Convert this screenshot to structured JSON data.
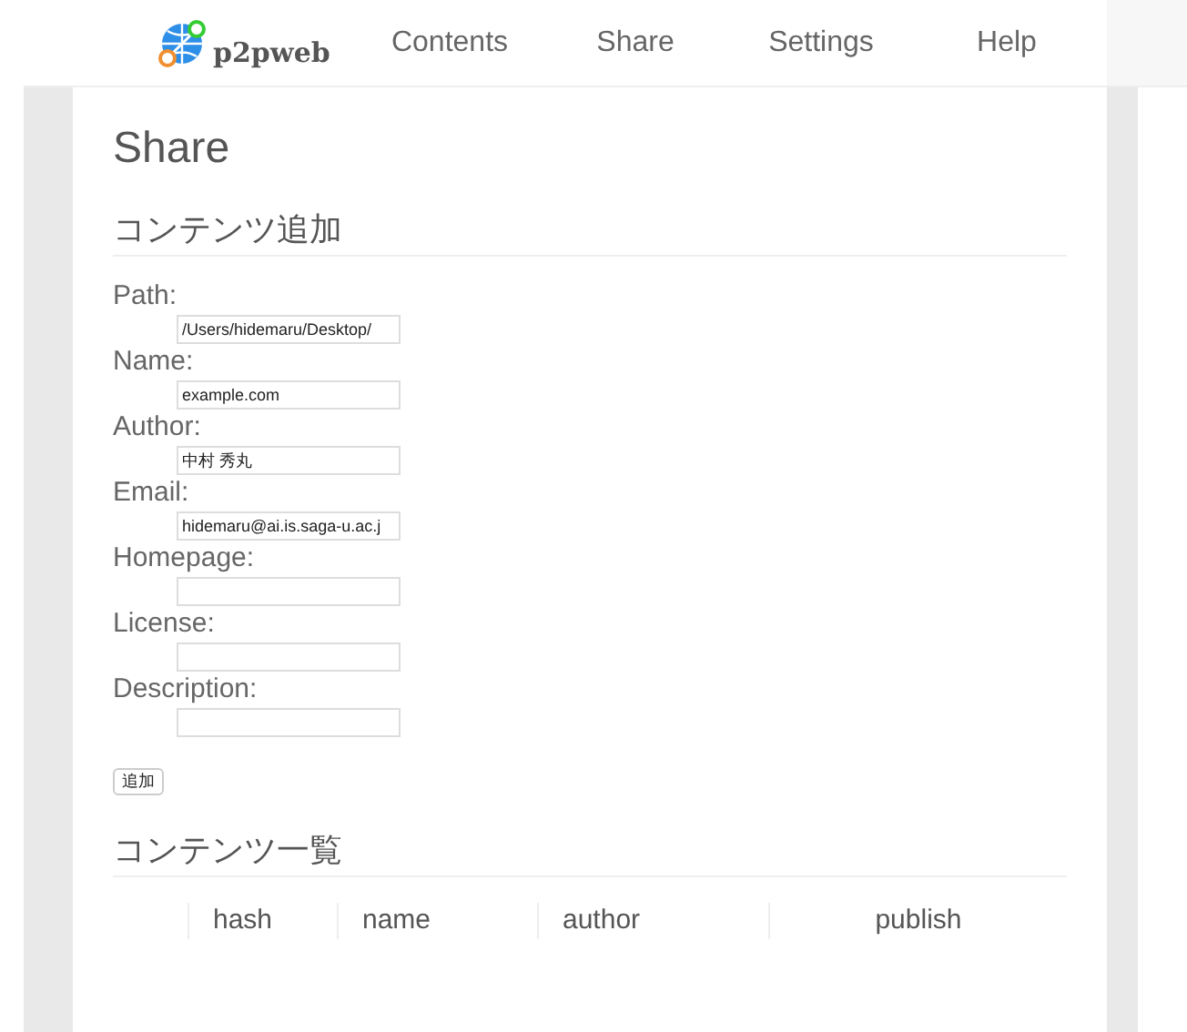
{
  "navbar": {
    "brand": "p2pweb",
    "items": [
      "Contents",
      "Share",
      "Settings",
      "Help"
    ]
  },
  "page_title": "Share",
  "add_section": {
    "heading": "コンテンツ追加",
    "fields": [
      {
        "label": "Path:",
        "value": "/Users/hidemaru/Desktop/"
      },
      {
        "label": "Name:",
        "value": "example.com"
      },
      {
        "label": "Author:",
        "value": "中村 秀丸"
      },
      {
        "label": "Email:",
        "value": "hidemaru@ai.is.saga-u.ac.j"
      },
      {
        "label": "Homepage:"
      },
      {
        "label": "License:"
      },
      {
        "label": "Description:"
      }
    ],
    "submit_button": "追加"
  },
  "list_section": {
    "heading": "コンテンツ一覧",
    "columns": [
      "hash",
      "name",
      "author",
      "publish"
    ]
  }
}
